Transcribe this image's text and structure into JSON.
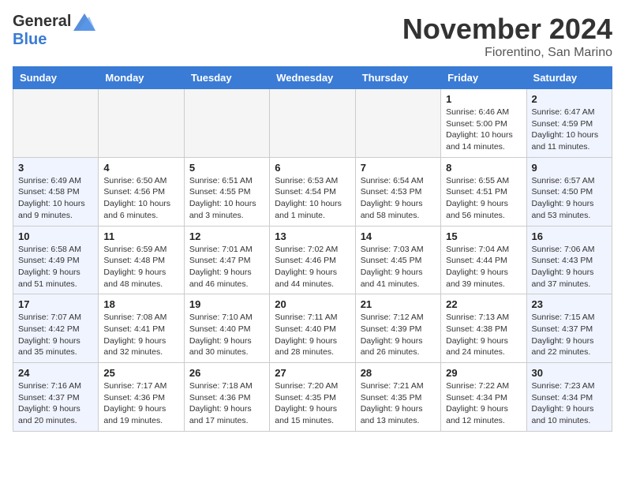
{
  "header": {
    "logo_general": "General",
    "logo_blue": "Blue",
    "month_title": "November 2024",
    "location": "Fiorentino, San Marino"
  },
  "days_of_week": [
    "Sunday",
    "Monday",
    "Tuesday",
    "Wednesday",
    "Thursday",
    "Friday",
    "Saturday"
  ],
  "weeks": [
    [
      {
        "day": "",
        "info": "",
        "empty": true
      },
      {
        "day": "",
        "info": "",
        "empty": true
      },
      {
        "day": "",
        "info": "",
        "empty": true
      },
      {
        "day": "",
        "info": "",
        "empty": true
      },
      {
        "day": "",
        "info": "",
        "empty": true
      },
      {
        "day": "1",
        "info": "Sunrise: 6:46 AM\nSunset: 5:00 PM\nDaylight: 10 hours and 14 minutes.",
        "empty": false,
        "weekend": false
      },
      {
        "day": "2",
        "info": "Sunrise: 6:47 AM\nSunset: 4:59 PM\nDaylight: 10 hours and 11 minutes.",
        "empty": false,
        "weekend": true
      }
    ],
    [
      {
        "day": "3",
        "info": "Sunrise: 6:49 AM\nSunset: 4:58 PM\nDaylight: 10 hours and 9 minutes.",
        "empty": false,
        "weekend": true
      },
      {
        "day": "4",
        "info": "Sunrise: 6:50 AM\nSunset: 4:56 PM\nDaylight: 10 hours and 6 minutes.",
        "empty": false,
        "weekend": false
      },
      {
        "day": "5",
        "info": "Sunrise: 6:51 AM\nSunset: 4:55 PM\nDaylight: 10 hours and 3 minutes.",
        "empty": false,
        "weekend": false
      },
      {
        "day": "6",
        "info": "Sunrise: 6:53 AM\nSunset: 4:54 PM\nDaylight: 10 hours and 1 minute.",
        "empty": false,
        "weekend": false
      },
      {
        "day": "7",
        "info": "Sunrise: 6:54 AM\nSunset: 4:53 PM\nDaylight: 9 hours and 58 minutes.",
        "empty": false,
        "weekend": false
      },
      {
        "day": "8",
        "info": "Sunrise: 6:55 AM\nSunset: 4:51 PM\nDaylight: 9 hours and 56 minutes.",
        "empty": false,
        "weekend": false
      },
      {
        "day": "9",
        "info": "Sunrise: 6:57 AM\nSunset: 4:50 PM\nDaylight: 9 hours and 53 minutes.",
        "empty": false,
        "weekend": true
      }
    ],
    [
      {
        "day": "10",
        "info": "Sunrise: 6:58 AM\nSunset: 4:49 PM\nDaylight: 9 hours and 51 minutes.",
        "empty": false,
        "weekend": true
      },
      {
        "day": "11",
        "info": "Sunrise: 6:59 AM\nSunset: 4:48 PM\nDaylight: 9 hours and 48 minutes.",
        "empty": false,
        "weekend": false
      },
      {
        "day": "12",
        "info": "Sunrise: 7:01 AM\nSunset: 4:47 PM\nDaylight: 9 hours and 46 minutes.",
        "empty": false,
        "weekend": false
      },
      {
        "day": "13",
        "info": "Sunrise: 7:02 AM\nSunset: 4:46 PM\nDaylight: 9 hours and 44 minutes.",
        "empty": false,
        "weekend": false
      },
      {
        "day": "14",
        "info": "Sunrise: 7:03 AM\nSunset: 4:45 PM\nDaylight: 9 hours and 41 minutes.",
        "empty": false,
        "weekend": false
      },
      {
        "day": "15",
        "info": "Sunrise: 7:04 AM\nSunset: 4:44 PM\nDaylight: 9 hours and 39 minutes.",
        "empty": false,
        "weekend": false
      },
      {
        "day": "16",
        "info": "Sunrise: 7:06 AM\nSunset: 4:43 PM\nDaylight: 9 hours and 37 minutes.",
        "empty": false,
        "weekend": true
      }
    ],
    [
      {
        "day": "17",
        "info": "Sunrise: 7:07 AM\nSunset: 4:42 PM\nDaylight: 9 hours and 35 minutes.",
        "empty": false,
        "weekend": true
      },
      {
        "day": "18",
        "info": "Sunrise: 7:08 AM\nSunset: 4:41 PM\nDaylight: 9 hours and 32 minutes.",
        "empty": false,
        "weekend": false
      },
      {
        "day": "19",
        "info": "Sunrise: 7:10 AM\nSunset: 4:40 PM\nDaylight: 9 hours and 30 minutes.",
        "empty": false,
        "weekend": false
      },
      {
        "day": "20",
        "info": "Sunrise: 7:11 AM\nSunset: 4:40 PM\nDaylight: 9 hours and 28 minutes.",
        "empty": false,
        "weekend": false
      },
      {
        "day": "21",
        "info": "Sunrise: 7:12 AM\nSunset: 4:39 PM\nDaylight: 9 hours and 26 minutes.",
        "empty": false,
        "weekend": false
      },
      {
        "day": "22",
        "info": "Sunrise: 7:13 AM\nSunset: 4:38 PM\nDaylight: 9 hours and 24 minutes.",
        "empty": false,
        "weekend": false
      },
      {
        "day": "23",
        "info": "Sunrise: 7:15 AM\nSunset: 4:37 PM\nDaylight: 9 hours and 22 minutes.",
        "empty": false,
        "weekend": true
      }
    ],
    [
      {
        "day": "24",
        "info": "Sunrise: 7:16 AM\nSunset: 4:37 PM\nDaylight: 9 hours and 20 minutes.",
        "empty": false,
        "weekend": true
      },
      {
        "day": "25",
        "info": "Sunrise: 7:17 AM\nSunset: 4:36 PM\nDaylight: 9 hours and 19 minutes.",
        "empty": false,
        "weekend": false
      },
      {
        "day": "26",
        "info": "Sunrise: 7:18 AM\nSunset: 4:36 PM\nDaylight: 9 hours and 17 minutes.",
        "empty": false,
        "weekend": false
      },
      {
        "day": "27",
        "info": "Sunrise: 7:20 AM\nSunset: 4:35 PM\nDaylight: 9 hours and 15 minutes.",
        "empty": false,
        "weekend": false
      },
      {
        "day": "28",
        "info": "Sunrise: 7:21 AM\nSunset: 4:35 PM\nDaylight: 9 hours and 13 minutes.",
        "empty": false,
        "weekend": false
      },
      {
        "day": "29",
        "info": "Sunrise: 7:22 AM\nSunset: 4:34 PM\nDaylight: 9 hours and 12 minutes.",
        "empty": false,
        "weekend": false
      },
      {
        "day": "30",
        "info": "Sunrise: 7:23 AM\nSunset: 4:34 PM\nDaylight: 9 hours and 10 minutes.",
        "empty": false,
        "weekend": true
      }
    ]
  ]
}
